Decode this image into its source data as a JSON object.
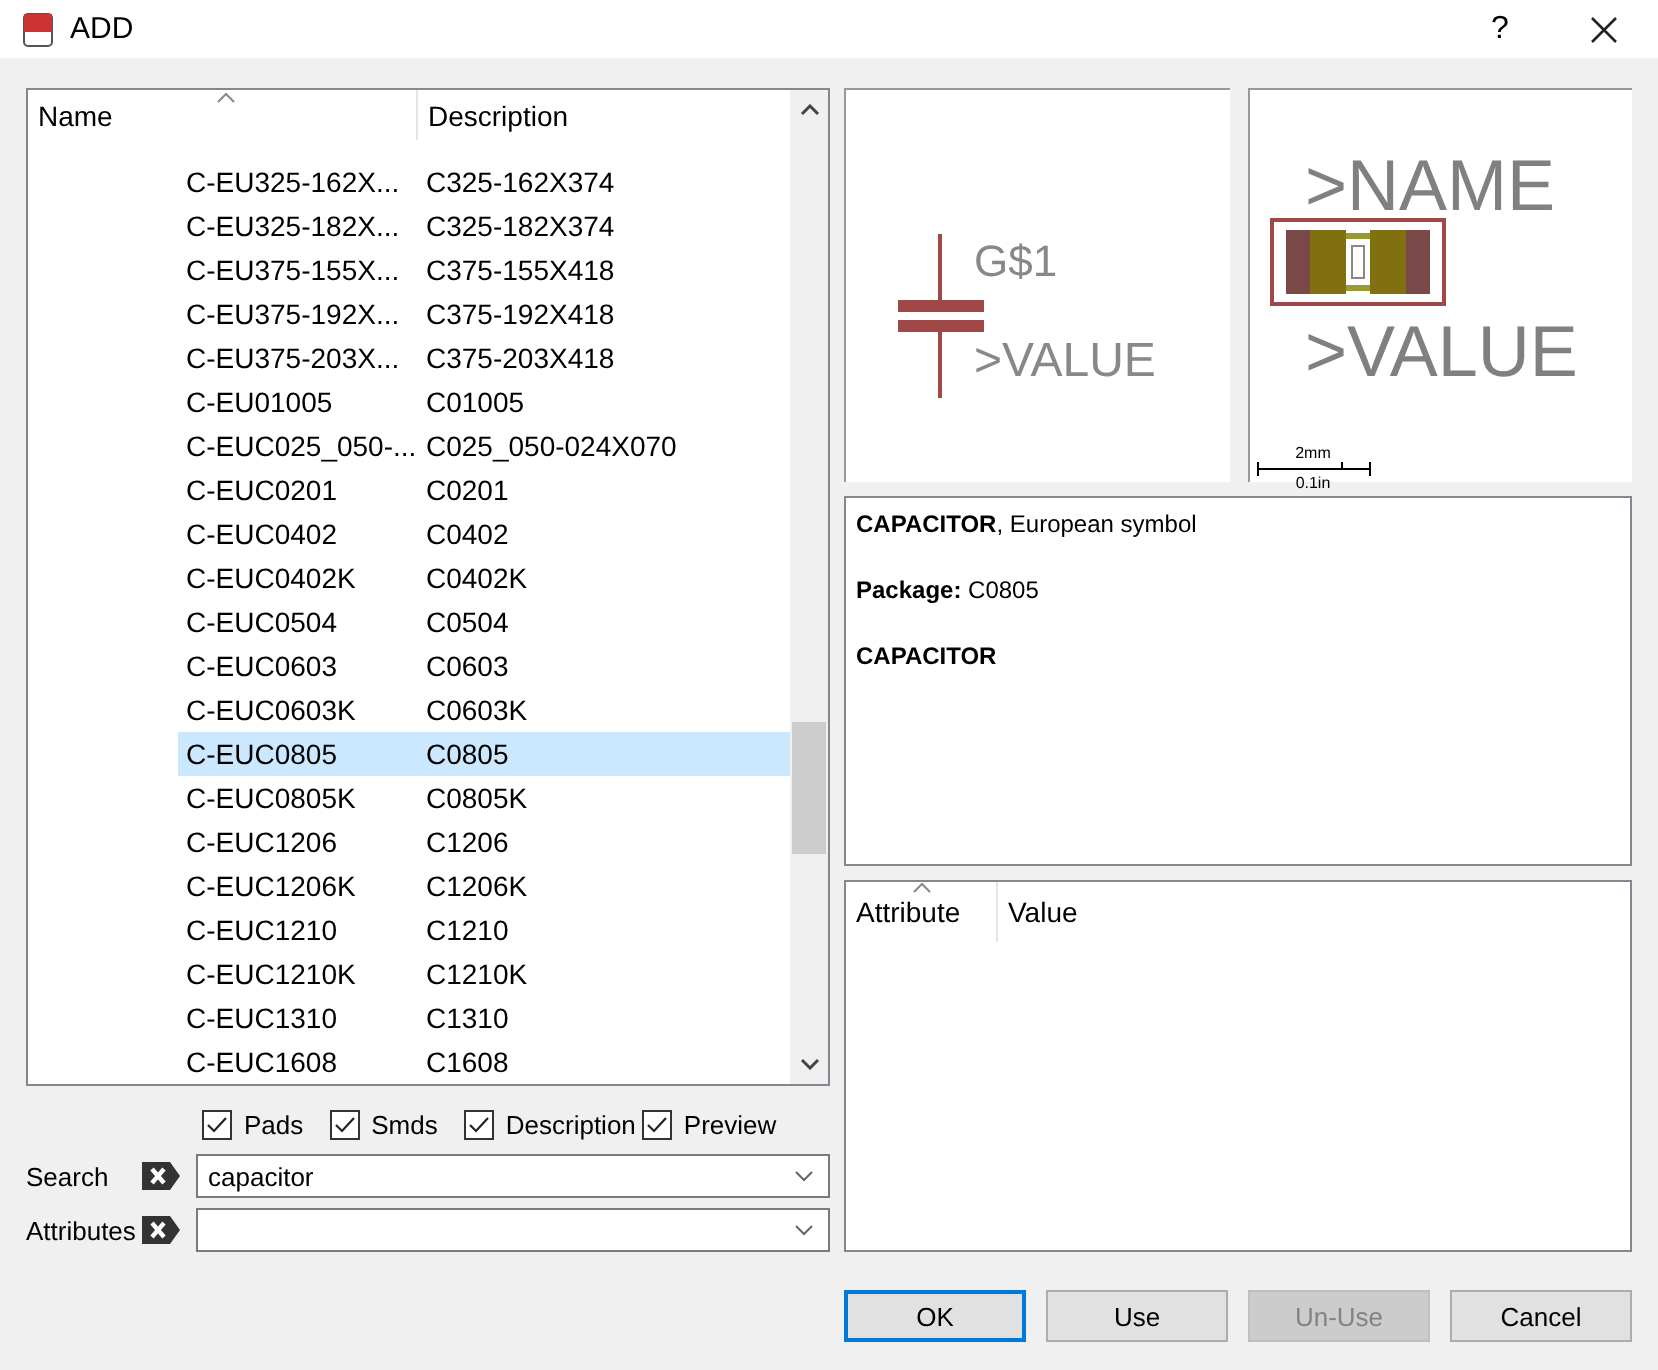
{
  "window": {
    "title": "ADD",
    "help": "?"
  },
  "list": {
    "columns": [
      "Name",
      "Description"
    ],
    "rows": [
      {
        "name": "C-EU325-162X...",
        "description": "C325-162X374",
        "selected": false
      },
      {
        "name": "C-EU325-182X...",
        "description": "C325-182X374",
        "selected": false
      },
      {
        "name": "C-EU375-155X...",
        "description": "C375-155X418",
        "selected": false
      },
      {
        "name": "C-EU375-192X...",
        "description": "C375-192X418",
        "selected": false
      },
      {
        "name": "C-EU375-203X...",
        "description": "C375-203X418",
        "selected": false
      },
      {
        "name": "C-EU01005",
        "description": "C01005",
        "selected": false
      },
      {
        "name": "C-EUC025_050-...",
        "description": "C025_050-024X070",
        "selected": false
      },
      {
        "name": "C-EUC0201",
        "description": "C0201",
        "selected": false
      },
      {
        "name": "C-EUC0402",
        "description": "C0402",
        "selected": false
      },
      {
        "name": "C-EUC0402K",
        "description": "C0402K",
        "selected": false
      },
      {
        "name": "C-EUC0504",
        "description": "C0504",
        "selected": false
      },
      {
        "name": "C-EUC0603",
        "description": "C0603",
        "selected": false
      },
      {
        "name": "C-EUC0603K",
        "description": "C0603K",
        "selected": false
      },
      {
        "name": "C-EUC0805",
        "description": "C0805",
        "selected": true
      },
      {
        "name": "C-EUC0805K",
        "description": "C0805K",
        "selected": false
      },
      {
        "name": "C-EUC1206",
        "description": "C1206",
        "selected": false
      },
      {
        "name": "C-EUC1206K",
        "description": "C1206K",
        "selected": false
      },
      {
        "name": "C-EUC1210",
        "description": "C1210",
        "selected": false
      },
      {
        "name": "C-EUC1210K",
        "description": "C1210K",
        "selected": false
      },
      {
        "name": "C-EUC1310",
        "description": "C1310",
        "selected": false
      },
      {
        "name": "C-EUC1608",
        "description": "C1608",
        "selected": false
      }
    ]
  },
  "options": [
    {
      "label": "Pads",
      "checked": true
    },
    {
      "label": "Smds",
      "checked": true
    },
    {
      "label": "Description",
      "checked": true
    },
    {
      "label": "Preview",
      "checked": true
    }
  ],
  "search": {
    "label": "Search",
    "value": "capacitor"
  },
  "attributes": {
    "label": "Attributes"
  },
  "symbol_preview": {
    "name": "G$1",
    "value": ">VALUE"
  },
  "package_preview": {
    "name": ">NAME",
    "value": ">VALUE",
    "scale_top": "2mm",
    "scale_bottom": "0.1in"
  },
  "description": [
    {
      "text": "**CAPACITOR**, European symbol",
      "bold": false
    },
    {
      "text": "**Package:** C0805",
      "bold": false
    },
    {
      "text": "CAPACITOR",
      "bold": true
    }
  ],
  "attribute_table": {
    "columns": [
      "Attribute",
      "Value"
    ]
  },
  "buttons": [
    {
      "label": "OK",
      "focused": true,
      "disabled": false
    },
    {
      "label": "Use",
      "focused": false,
      "disabled": false
    },
    {
      "label": "Un-Use",
      "focused": false,
      "disabled": true
    },
    {
      "label": "Cancel",
      "focused": false,
      "disabled": false
    }
  ]
}
